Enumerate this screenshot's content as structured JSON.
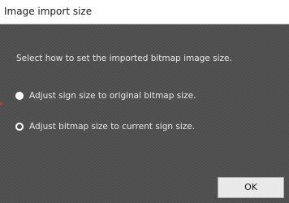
{
  "dialog": {
    "title": "Image import size",
    "prompt": "Select how to set the imported bitmap image size.",
    "options": [
      {
        "label": "Adjust sign size to original bitmap size.",
        "selected": false
      },
      {
        "label": "Adjust bitmap size to current sign size.",
        "selected": true
      }
    ],
    "ok_label": "OK"
  }
}
